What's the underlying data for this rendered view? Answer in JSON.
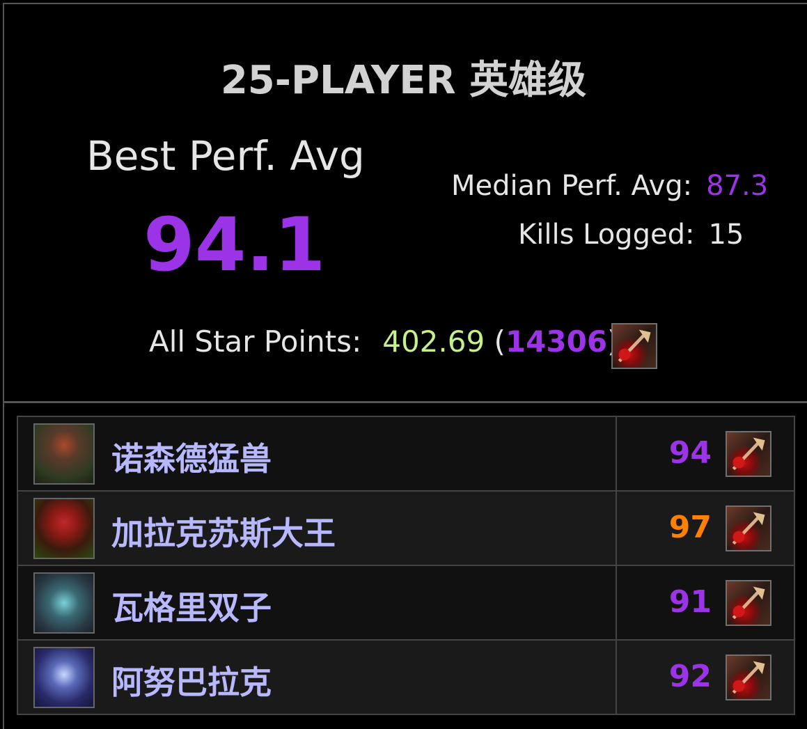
{
  "title": "25-PLAYER 英雄级",
  "best": {
    "label": "Best Perf. Avg",
    "value": "94.1"
  },
  "median": {
    "label": "Median Perf. Avg:",
    "value": "87.3"
  },
  "kills": {
    "label": "Kills Logged:",
    "value": "15"
  },
  "allstar": {
    "label": "All Star Points:",
    "points": "402.69",
    "open": "(",
    "rank": "14306",
    "close": ")"
  },
  "colors": {
    "purple": "#9b33e6",
    "orange": "#ff8000",
    "green": "#c5f08c",
    "boss_name": "#b8b8ff"
  },
  "class_icon": "fury-warrior-spec-icon",
  "bosses": [
    {
      "name": "诺森德猛兽",
      "score": "94",
      "score_color": "#9b33e6",
      "portrait": "northrend-beasts-portrait"
    },
    {
      "name": "加拉克苏斯大王",
      "score": "97",
      "score_color": "#ff8000",
      "portrait": "jaraxxus-portrait"
    },
    {
      "name": "瓦格里双子",
      "score": "91",
      "score_color": "#9b33e6",
      "portrait": "valkyr-twins-portrait"
    },
    {
      "name": "阿努巴拉克",
      "score": "92",
      "score_color": "#9b33e6",
      "portrait": "anubarak-portrait"
    }
  ]
}
